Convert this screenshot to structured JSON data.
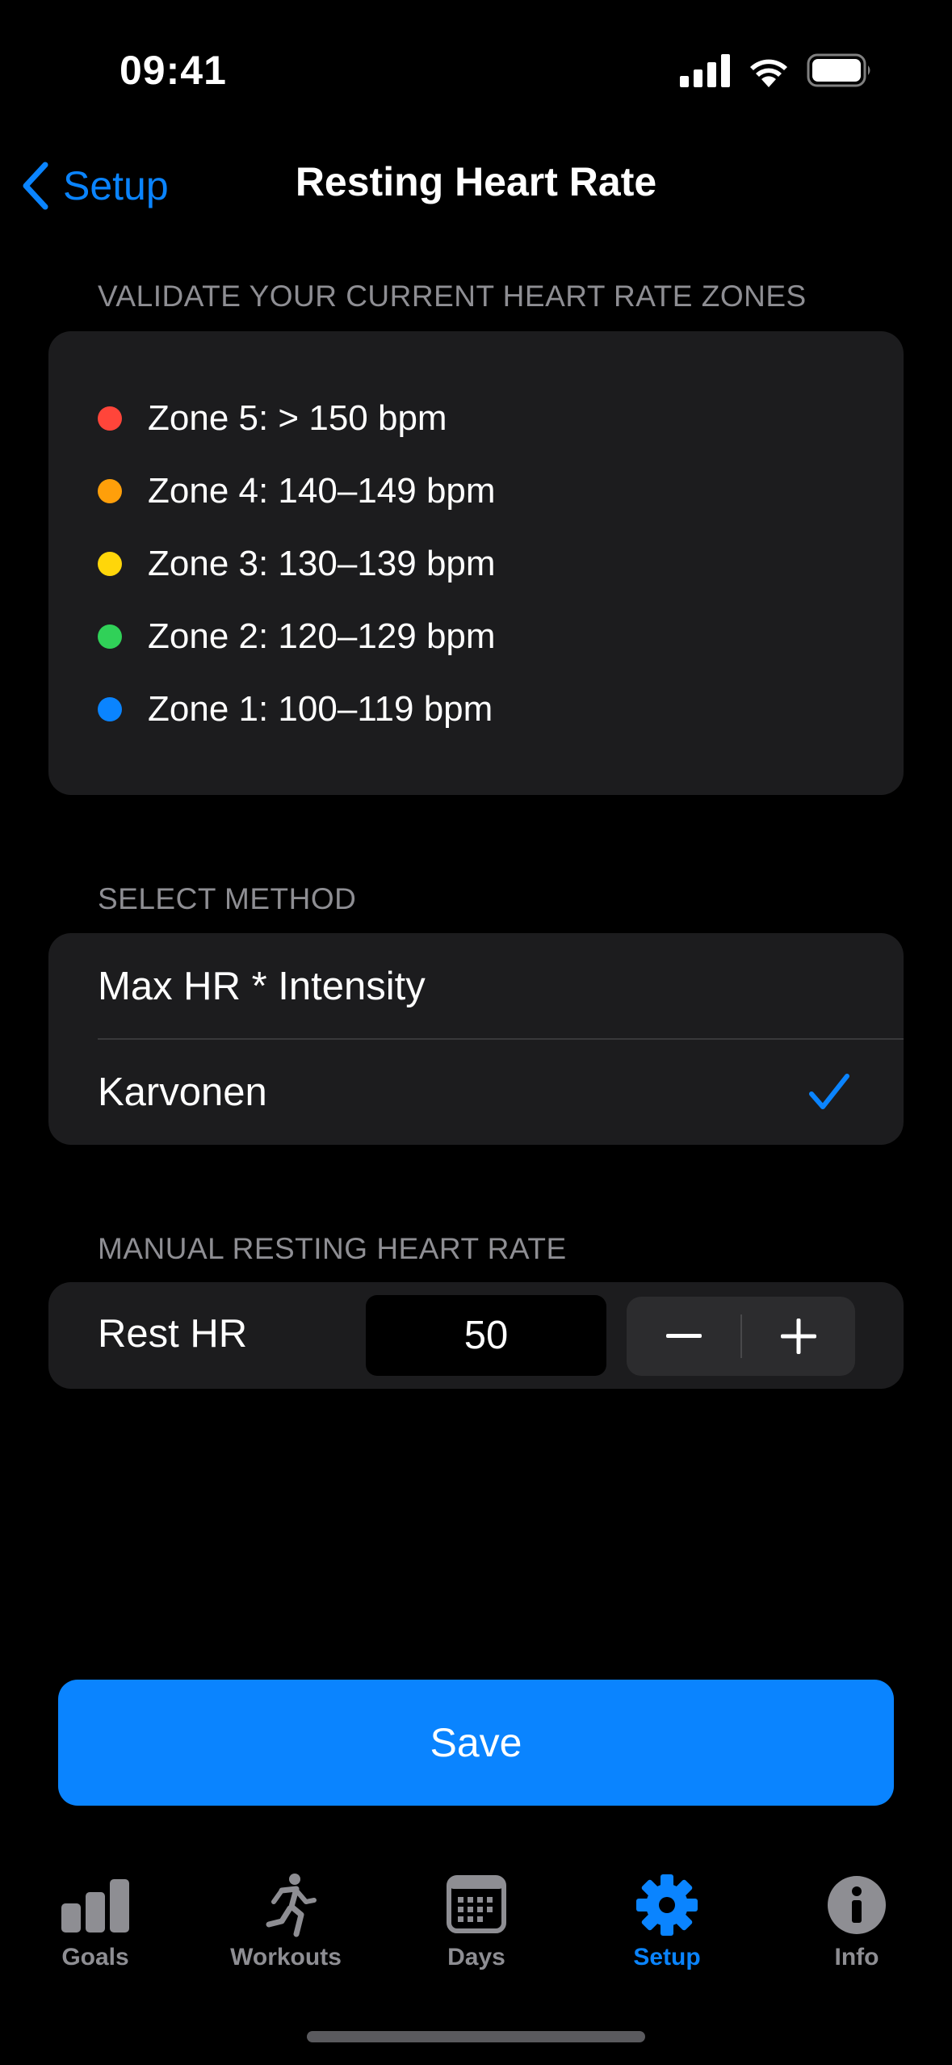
{
  "status_bar": {
    "time": "09:41"
  },
  "nav": {
    "back_label": "Setup",
    "title": "Resting Heart Rate"
  },
  "zones_section": {
    "header": "VALIDATE YOUR CURRENT HEART RATE ZONES",
    "zones": [
      {
        "label": "Zone 5: > 150 bpm",
        "color": "#ff453a"
      },
      {
        "label": "Zone 4: 140–149 bpm",
        "color": "#ff9f0a"
      },
      {
        "label": "Zone 3: 130–139 bpm",
        "color": "#ffd60a"
      },
      {
        "label": "Zone 2: 120–129 bpm",
        "color": "#30d158"
      },
      {
        "label": "Zone 1: 100–119 bpm",
        "color": "#0a84ff"
      }
    ]
  },
  "method_section": {
    "header": "SELECT METHOD",
    "options": [
      {
        "label": "Max HR * Intensity",
        "selected": false
      },
      {
        "label": "Karvonen",
        "selected": true
      }
    ]
  },
  "rest_section": {
    "header": "MANUAL RESTING HEART RATE",
    "label": "Rest HR",
    "value": "50"
  },
  "save_button": {
    "label": "Save"
  },
  "tab_bar": {
    "tabs": [
      {
        "label": "Goals",
        "icon": "chart-bars-icon",
        "active": false
      },
      {
        "label": "Workouts",
        "icon": "runner-icon",
        "active": false
      },
      {
        "label": "Days",
        "icon": "calendar-icon",
        "active": false
      },
      {
        "label": "Setup",
        "icon": "gear-icon",
        "active": true
      },
      {
        "label": "Info",
        "icon": "info-icon",
        "active": false
      }
    ]
  },
  "colors": {
    "accent": "#0a84ff",
    "card": "#1c1c1e",
    "secondary_text": "#8e8e93"
  }
}
